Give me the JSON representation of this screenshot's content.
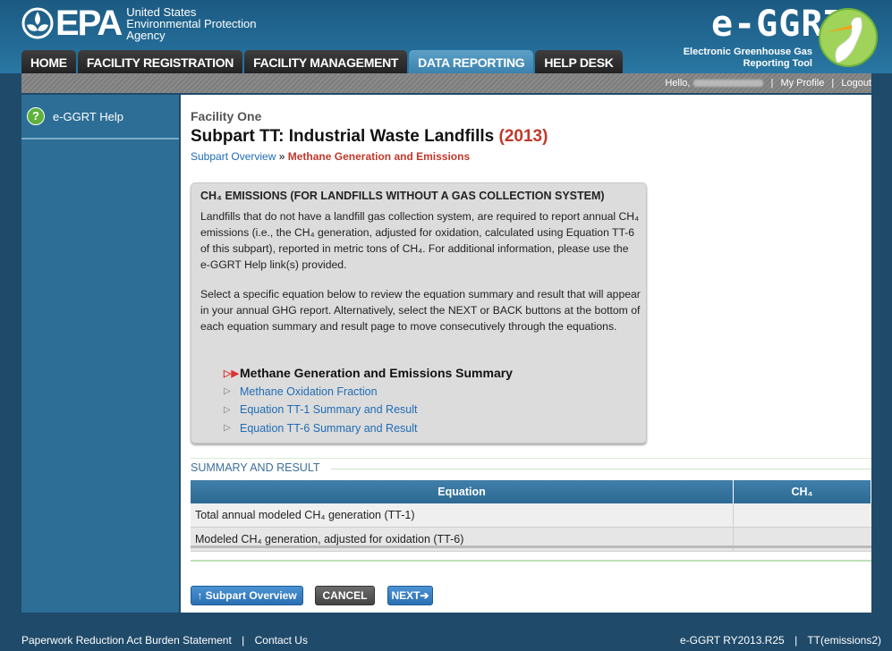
{
  "header": {
    "agency_line1": "United States",
    "agency_line2": "Environmental Protection",
    "agency_line3": "Agency",
    "epa_word": "EPA",
    "tool_title": "e-GGRT",
    "tool_sub_line1": "Electronic Greenhouse Gas",
    "tool_sub_line2": "Reporting Tool"
  },
  "nav": {
    "tabs": [
      {
        "label": "HOME"
      },
      {
        "label": "FACILITY REGISTRATION"
      },
      {
        "label": "FACILITY MANAGEMENT"
      },
      {
        "label": "DATA REPORTING"
      },
      {
        "label": "HELP DESK"
      }
    ],
    "active": "DATA REPORTING"
  },
  "util": {
    "hello": "Hello,",
    "my_profile": "My Profile",
    "logout": "Logout"
  },
  "sidebar": {
    "help_label": "e-GGRT Help"
  },
  "page": {
    "facility": "Facility One",
    "subpart_title": "Subpart TT: Industrial Waste Landfills",
    "year": "(2013)",
    "breadcrumb_link": "Subpart Overview",
    "breadcrumb_sep": "»",
    "breadcrumb_current": "Methane Generation and Emissions"
  },
  "infobox": {
    "heading": "CH₄ EMISSIONS (FOR LANDFILLS WITHOUT A GAS COLLECTION SYSTEM)",
    "para1": "Landfills that do not have a landfill gas collection system, are required to report annual CH₄ emissions (i.e., the CH₄ generation, adjusted for oxidation, calculated using Equation TT-6 of this subpart), reported in metric tons of CH₄. For additional information, please use the e-GGRT Help link(s) provided.",
    "para2": "Select a specific equation below to review the equation summary and result that will appear in your annual GHG report. Alternatively, select the NEXT or BACK buttons at the bottom of each equation summary and result page to move consecutively through the equations.",
    "items": [
      {
        "label": "Methane Generation and Emissions Summary"
      },
      {
        "label": "Methane Oxidation Fraction"
      },
      {
        "label": "Equation TT-1 Summary and Result"
      },
      {
        "label": "Equation TT-6 Summary and Result"
      }
    ]
  },
  "summary": {
    "label": "SUMMARY AND RESULT",
    "col_equation": "Equation",
    "col_value": "CH₄",
    "rows": [
      {
        "equation": "Total annual modeled CH₄ generation (TT-1)",
        "value": ""
      },
      {
        "equation": "Modeled CH₄ generation, adjusted for oxidation (TT-6)",
        "value": ""
      }
    ]
  },
  "buttons": {
    "overview": "↑ Subpart Overview",
    "cancel": "CANCEL",
    "next": "NEXT➔"
  },
  "footer": {
    "paperwork": "Paperwork Reduction Act Burden Statement",
    "contact": "Contact Us",
    "version": "e-GGRT RY2013.R25",
    "page_id": "TT(emissions2)"
  }
}
